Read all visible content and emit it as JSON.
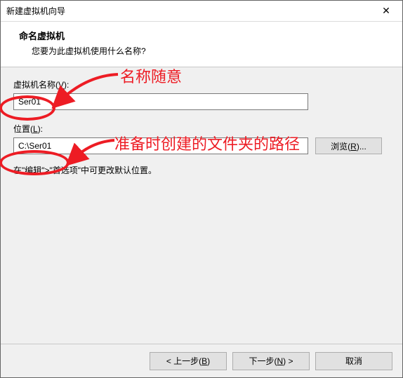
{
  "window": {
    "title": "新建虚拟机向导",
    "close_glyph": "✕"
  },
  "header": {
    "title": "命名虚拟机",
    "subtitle": "您要为此虚拟机使用什么名称?"
  },
  "fields": {
    "name_label_pre": "虚拟机名称(",
    "name_label_u": "V",
    "name_label_post": "):",
    "name_value": "Ser01",
    "location_label_pre": "位置(",
    "location_label_u": "L",
    "location_label_post": "):",
    "location_value": "C:\\Ser01",
    "browse_pre": "浏览(",
    "browse_u": "R",
    "browse_post": ")..."
  },
  "hint": "在\"编辑\">\"首选项\"中可更改默认位置。",
  "footer": {
    "back_pre": "< 上一步(",
    "back_u": "B",
    "back_post": ")",
    "next_pre": "下一步(",
    "next_u": "N",
    "next_post": ") >",
    "cancel": "取消"
  },
  "annotations": {
    "name_note": "名称随意",
    "location_note": "准备时创建的文件夹的路径"
  }
}
